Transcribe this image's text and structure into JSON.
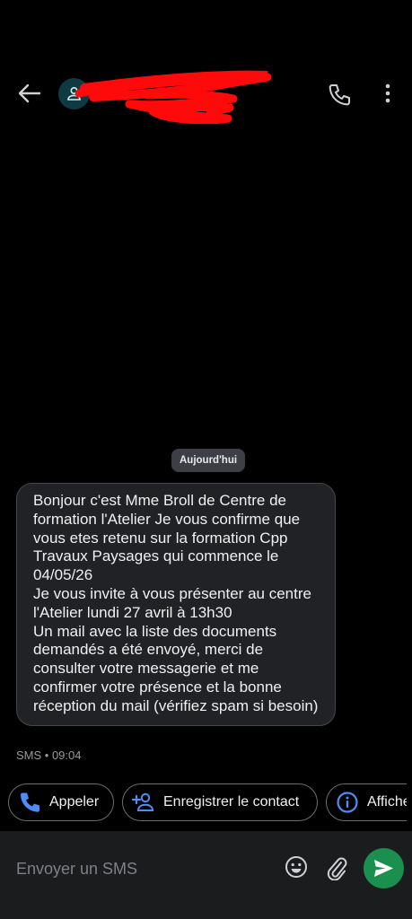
{
  "header": {
    "icons": {
      "back": "back-arrow-icon",
      "avatar": "person-icon",
      "call": "phone-icon",
      "menu": "more-vertical-icon"
    },
    "redaction_color": "#ff0000"
  },
  "date_chip": "Aujourd'hui",
  "message": {
    "text": "Bonjour c'est Mme Broll de Centre de formation l'Atelier Je vous confirme que vous etes retenu sur la formation Cpp Travaux Paysages qui commence le 04/05/26\nJe vous invite à vous présenter au centre l'Atelier lundi 27 avril à 13h30\nUn mail avec la liste des documents demandés a été envoyé, merci de consulter votre messagerie et me confirmer votre présence et la bonne réception du mail (vérifiez spam si besoin)",
    "meta": "SMS • 09:04"
  },
  "actions": [
    {
      "label": "Appeler",
      "icon": "phone-icon"
    },
    {
      "label": "Enregistrer le contact",
      "icon": "add-person-icon"
    },
    {
      "label": "Afficher",
      "icon": "info-icon"
    }
  ],
  "composer": {
    "placeholder": "Envoyer un SMS",
    "icons": {
      "emoji": "emoji-icon",
      "attach": "paperclip-icon",
      "send": "send-icon"
    },
    "send_color": "#1b8f4e"
  },
  "colors": {
    "accent": "#4c8df6",
    "background": "#000000",
    "bubble": "#212225"
  }
}
